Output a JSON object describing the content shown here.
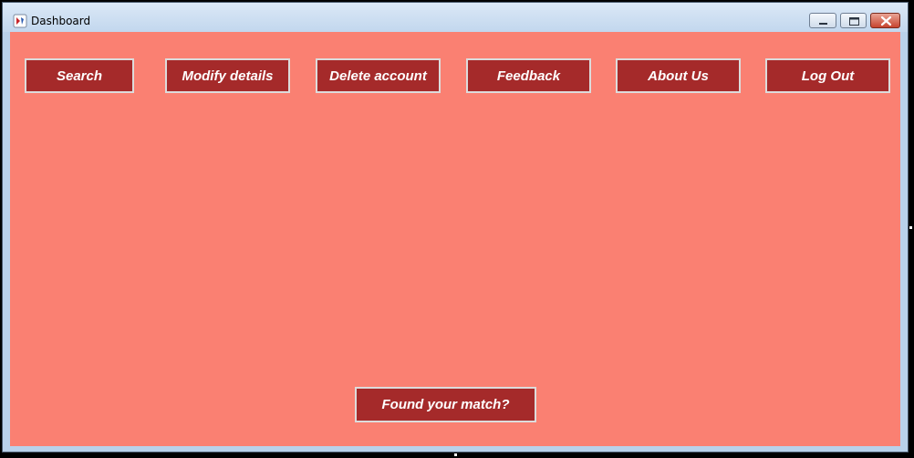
{
  "window": {
    "title": "Dashboard",
    "controls": [
      "minimize-icon",
      "maximize-icon",
      "close-icon"
    ]
  },
  "toolbar": {
    "search": "Search",
    "modify_details": "Modify details",
    "delete_account": "Delete account",
    "feedback": "Feedback",
    "about_us": "About Us",
    "log_out": "Log Out"
  },
  "footer": {
    "found_match": "Found your match?"
  },
  "colors": {
    "background": "#fa8072",
    "button": "#a52a2a",
    "button_text": "#ffffff",
    "button_border": "#dcdcdc"
  }
}
